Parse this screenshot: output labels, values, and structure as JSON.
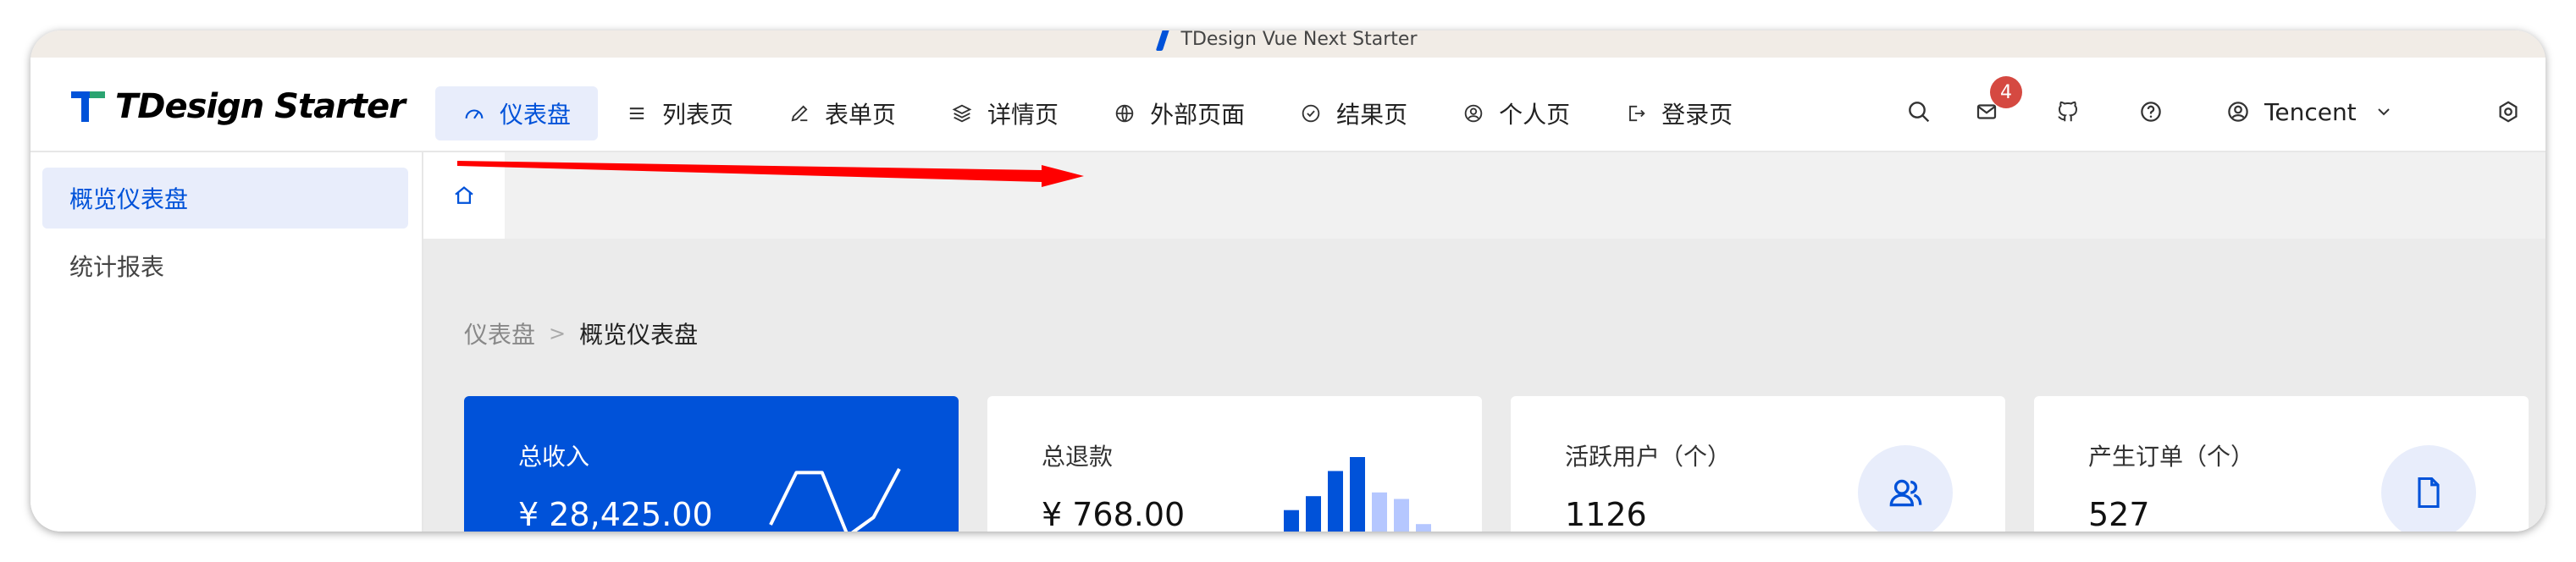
{
  "window": {
    "title": "TDesign Vue Next Starter"
  },
  "header": {
    "logo_text": "TDesign Starter",
    "nav": [
      {
        "label": "仪表盘",
        "icon": "dashboard-icon",
        "active": true
      },
      {
        "label": "列表页",
        "icon": "list-icon"
      },
      {
        "label": "表单页",
        "icon": "edit-icon"
      },
      {
        "label": "详情页",
        "icon": "layers-icon"
      },
      {
        "label": "外部页面",
        "icon": "globe-icon"
      },
      {
        "label": "结果页",
        "icon": "check-circle-icon"
      },
      {
        "label": "个人页",
        "icon": "user-circle-icon"
      },
      {
        "label": "登录页",
        "icon": "logout-icon"
      }
    ],
    "notification_count": "4",
    "user_name": "Tencent"
  },
  "sidebar": {
    "items": [
      {
        "label": "概览仪表盘",
        "active": true
      },
      {
        "label": "统计报表"
      }
    ]
  },
  "breadcrumb": {
    "parent": "仪表盘",
    "current": "概览仪表盘"
  },
  "cards": [
    {
      "label": "总收入",
      "value": "¥ 28,425.00",
      "chart": "line"
    },
    {
      "label": "总退款",
      "value": "¥ 768.00",
      "chart": "bar"
    },
    {
      "label": "活跃用户（个）",
      "value": "1126",
      "icon": "users-icon"
    },
    {
      "label": "产生订单（个）",
      "value": "527",
      "icon": "file-icon"
    }
  ],
  "mini_charts": {
    "revenue_trend": [
      0.25,
      0.95,
      0.95,
      0.1,
      0.35,
      1.0
    ],
    "refund_bars": [
      0.43,
      0.58,
      0.85,
      1.0,
      0.62,
      0.55,
      0.28
    ],
    "refund_bars_highlighted": 4
  },
  "colors": {
    "brand": "#0052d9",
    "brand_light": "#e8edfb",
    "badge": "#d54941",
    "annotation_arrow": "#ff0000"
  }
}
